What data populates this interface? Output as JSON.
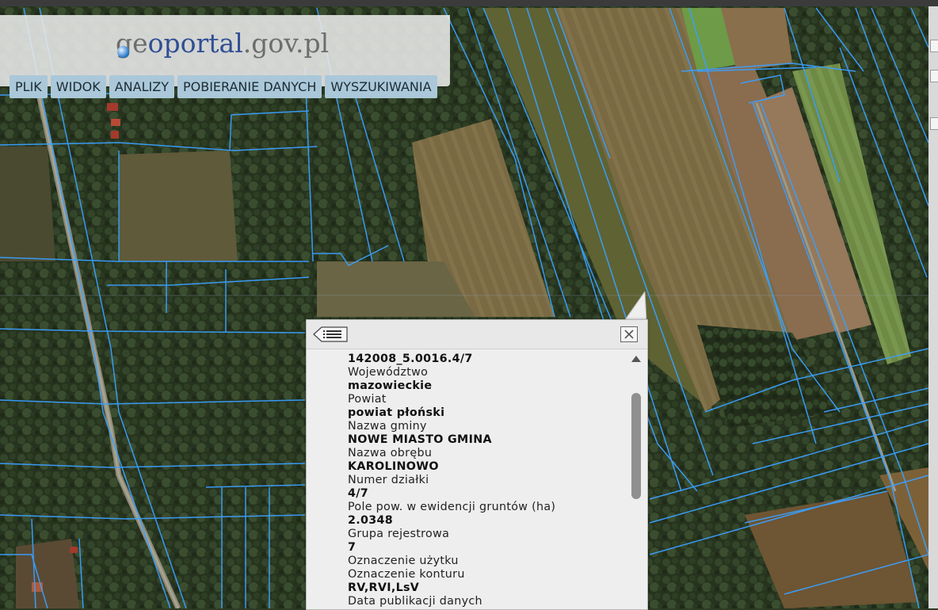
{
  "app": {
    "logo": {
      "geo": "ge",
      "portal": "oportal",
      "domain": ".gov.pl"
    }
  },
  "menu": {
    "items": [
      "PLIK",
      "WIDOK",
      "ANALIZY",
      "POBIERANIE DANYCH",
      "WYSZUKIWANIA"
    ]
  },
  "icons": {
    "logo": "globe-icon",
    "back": "list-back-icon",
    "close": "close-icon",
    "scroll_up": "triangle-up-icon"
  },
  "popup": {
    "rows": [
      {
        "text": "142008_5.0016.4/7",
        "kind": "value"
      },
      {
        "text": "Województwo",
        "kind": "label"
      },
      {
        "text": "mazowieckie",
        "kind": "value"
      },
      {
        "text": "Powiat",
        "kind": "label"
      },
      {
        "text": "powiat płoński",
        "kind": "value"
      },
      {
        "text": "Nazwa gminy",
        "kind": "label"
      },
      {
        "text": "NOWE MIASTO GMINA",
        "kind": "value"
      },
      {
        "text": "Nazwa obrębu",
        "kind": "label"
      },
      {
        "text": "KAROLINOWO",
        "kind": "value"
      },
      {
        "text": "Numer działki",
        "kind": "label"
      },
      {
        "text": "4/7",
        "kind": "value"
      },
      {
        "text": "Pole pow. w ewidencji gruntów (ha)",
        "kind": "label"
      },
      {
        "text": "2.0348",
        "kind": "value"
      },
      {
        "text": "Grupa rejestrowa",
        "kind": "label"
      },
      {
        "text": "7",
        "kind": "value"
      },
      {
        "text": "Oznaczenie użytku",
        "kind": "label"
      },
      {
        "text": "Oznaczenie konturu",
        "kind": "label"
      },
      {
        "text": "RV,RVI,LsV",
        "kind": "value"
      },
      {
        "text": "Data publikacji danych",
        "kind": "label"
      }
    ]
  },
  "colors": {
    "parcel_line": "#3aa0ff",
    "menu_bg": "#aac8d9",
    "logo_blue": "#2f4f95"
  }
}
